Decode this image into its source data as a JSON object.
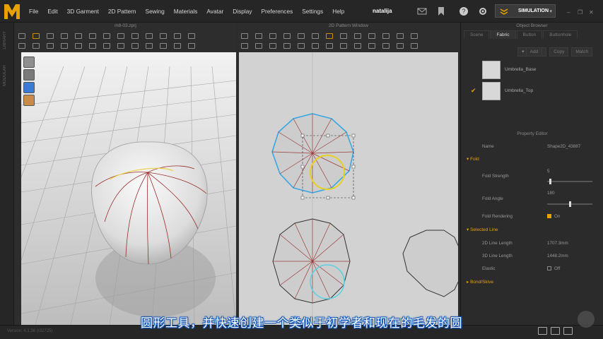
{
  "app": {
    "menu": [
      "File",
      "Edit",
      "3D Garment",
      "2D Pattern",
      "Sewing",
      "Materials",
      "Avatar",
      "Display",
      "Preferences",
      "Settings",
      "Help"
    ],
    "user_prefix": "natalija",
    "mode": "SIMULATION",
    "brand_color": "#e8a200"
  },
  "panel3d": {
    "title": "m8-03.zprj"
  },
  "panel2d": {
    "title": "2D Pattern Window"
  },
  "object_browser": {
    "title": "Object Browser",
    "tabs": [
      "Scene",
      "Fabric",
      "Button",
      "Buttonhole"
    ],
    "active_tab": "Fabric",
    "buttons": [
      "Add",
      "Copy",
      "Match"
    ],
    "fabrics": [
      {
        "name": "Umbrella_Base",
        "checked": false
      },
      {
        "name": "Umbrella_Top",
        "checked": true
      }
    ]
  },
  "property_editor": {
    "title": "Property Editor",
    "name_label": "Name",
    "name_value": "Shape2D_43887",
    "fold_section": "Fold",
    "fold_strength_label": "Fold Strength",
    "fold_strength_value": "5",
    "fold_strength_frac": 0.05,
    "fold_angle_label": "Fold Angle",
    "fold_angle_value": "180",
    "fold_angle_frac": 0.5,
    "fold_rendering_label": "Fold Rendering",
    "fold_rendering_value": "On",
    "selected_line_section": "Selected Line",
    "line2d_label": "2D Line Length",
    "line2d_value": "1707.3mm",
    "line3d_label": "3D Line Length",
    "line3d_value": "1448.2mm",
    "elastic_label": "Elastic",
    "elastic_value": "Off",
    "bond_section": "Bond/Skive"
  },
  "status": {
    "version": "Version: 4.1.36 (r32725)"
  },
  "subtitle": "圆形工具，并快速创建一个类似于初学者和现在的毛发的圆"
}
